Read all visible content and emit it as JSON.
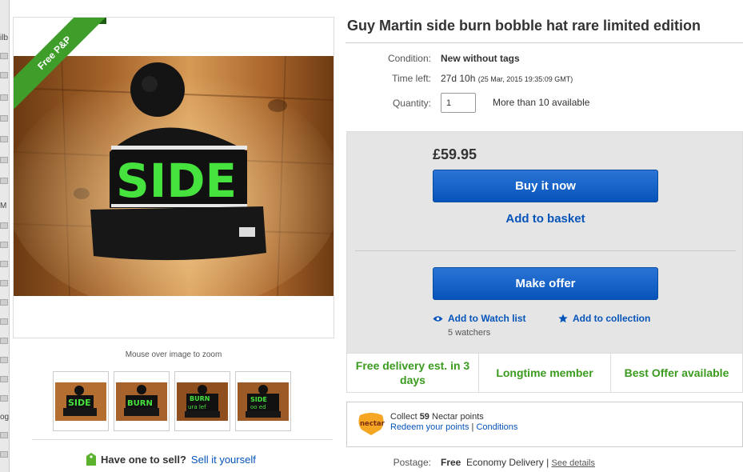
{
  "listing": {
    "title": "Guy Martin side burn bobble hat rare limited edition",
    "ribbon": "Free P&P",
    "zoom_hint": "Mouse over image to zoom"
  },
  "specs": {
    "condition_label": "Condition:",
    "condition_value": "New without tags",
    "time_left_label": "Time left:",
    "time_left_value": "27d 10h",
    "time_left_detail": "(25 Mar, 2015  19:35:09 GMT)",
    "quantity_label": "Quantity:",
    "quantity_value": "1",
    "availability": "More than 10 available"
  },
  "buy_box": {
    "price": "£59.95",
    "buy_now_label": "Buy it now",
    "add_to_basket_label": "Add to basket",
    "make_offer_label": "Make offer",
    "watch_label": "Add to Watch list",
    "collection_label": "Add to collection",
    "watchers": "5 watchers"
  },
  "features": [
    "Free delivery est. in 3 days",
    "Longtime member",
    "Best Offer available"
  ],
  "nectar": {
    "collect_prefix": "Collect ",
    "collect_points": "59",
    "collect_suffix": " Nectar points",
    "redeem_label": "Redeem your points",
    "separator": "|",
    "conditions_label": "Conditions",
    "logo_text": "nectar"
  },
  "postage": {
    "label": "Postage:",
    "value": "Free",
    "service": "Economy Delivery",
    "separator": "|",
    "details_label": "See details"
  },
  "sell": {
    "question": "Have one to sell?",
    "link": "Sell it yourself"
  },
  "left_sliver": {
    "letters": [
      "ilb",
      "M",
      "og"
    ]
  },
  "colors": {
    "brand_blue": "#0654ba",
    "feature_green": "#3a9b1e",
    "ribbon_green": "#3f9e2a"
  }
}
